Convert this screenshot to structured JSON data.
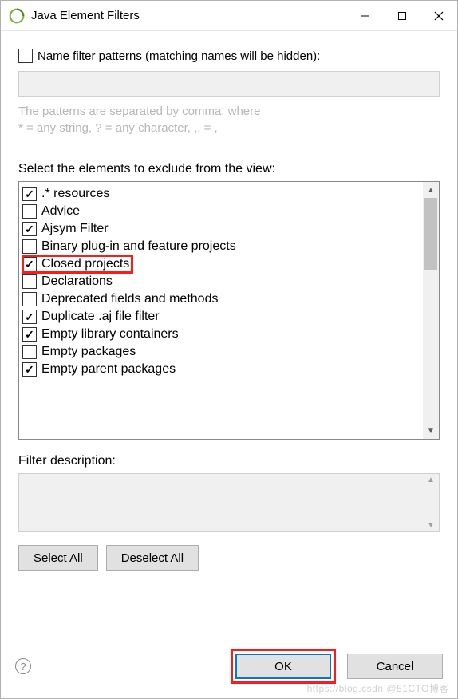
{
  "window": {
    "title": "Java Element Filters"
  },
  "name_filter": {
    "checkbox_label": "Name filter patterns (matching names will be hidden):",
    "checked": false,
    "hint_line1": "The patterns are separated by comma, where",
    "hint_line2": "* = any string, ? = any character, ,, = ,"
  },
  "list": {
    "label": "Select the elements to exclude from the view:",
    "items": [
      {
        "label": ".* resources",
        "checked": true
      },
      {
        "label": "Advice",
        "checked": false
      },
      {
        "label": "Ajsym Filter",
        "checked": true
      },
      {
        "label": "Binary plug-in and feature projects",
        "checked": false
      },
      {
        "label": "Closed projects",
        "checked": true,
        "highlight": true
      },
      {
        "label": "Declarations",
        "checked": false
      },
      {
        "label": "Deprecated fields and methods",
        "checked": false
      },
      {
        "label": "Duplicate .aj file filter",
        "checked": true
      },
      {
        "label": "Empty library containers",
        "checked": true
      },
      {
        "label": "Empty packages",
        "checked": false
      },
      {
        "label": "Empty parent packages",
        "checked": true
      }
    ]
  },
  "description": {
    "label": "Filter description:"
  },
  "buttons": {
    "select_all": "Select All",
    "deselect_all": "Deselect All",
    "ok": "OK",
    "cancel": "Cancel"
  },
  "watermark": "https://blog.csdn @51CTO博客"
}
